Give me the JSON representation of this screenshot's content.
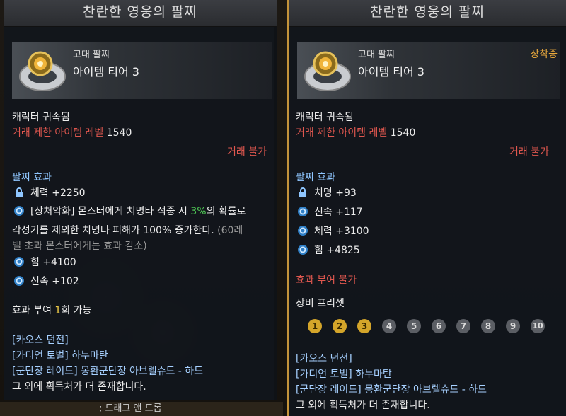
{
  "bottom_strip": "; 드래그 앤 드롭",
  "left": {
    "title": "찬란한 영웅의 팔찌",
    "item": {
      "grade": "고대 팔찌",
      "tier": "아이템 티어 3"
    },
    "bound": "캐릭터 귀속됨",
    "trade_level_label": "거래 제한 아이템 레벨",
    "trade_level_value": "1540",
    "trade_status": "거래 불가",
    "effects_header": "팔찌 효과",
    "effects": [
      {
        "icon": "lock-icon",
        "text": "체력 +2250"
      },
      {
        "icon": "swirl-icon",
        "text": "[상처악화] 몬스터에게 치명타 적중 시 ",
        "highlight": "3%",
        "suffix": "의 확률로"
      }
    ],
    "effect_cont_1": "각성기를 제외한 치명타 피해가 100% 증가한다.",
    "effect_cont_1_gray": " (60레",
    "effect_cont_2": "벨 초과 몬스터에게는 효과 감소)",
    "stats": [
      {
        "icon": "swirl-icon",
        "text": "힘 +4100"
      },
      {
        "icon": "swirl-icon",
        "text": "신속 +102"
      }
    ],
    "grant_prefix": "효과 부여 ",
    "grant_count": "1",
    "grant_suffix": "회 가능",
    "sources": [
      "[카오스 던전]",
      "[가디언 토벌] 하누마탄",
      "[군단장 레이드] 몽환군단장 아브렐슈드 - 하드"
    ],
    "more": "그 외에 획득처가 더 존재합니다."
  },
  "right": {
    "title": "찬란한 영웅의 팔찌",
    "item": {
      "grade": "고대 팔찌",
      "tier": "아이템 티어 3",
      "equipped": "장착중"
    },
    "bound": "캐릭터 귀속됨",
    "trade_level_label": "거래 제한 아이템 레벨",
    "trade_level_value": "1540",
    "trade_status": "거래 불가",
    "effects_header": "팔찌 효과",
    "effects": [
      {
        "icon": "lock-icon",
        "text": "치명 +93"
      },
      {
        "icon": "swirl-icon",
        "text": "신속 +117"
      },
      {
        "icon": "swirl-icon",
        "text": "체력 +3100"
      },
      {
        "icon": "swirl-icon",
        "text": "힘 +4825"
      }
    ],
    "grant_status": "효과 부여 불가",
    "preset_header": "장비 프리셋",
    "presets": [
      {
        "label": "1",
        "active": true
      },
      {
        "label": "2",
        "active": true
      },
      {
        "label": "3",
        "active": true
      },
      {
        "label": "4",
        "active": false
      },
      {
        "label": "5",
        "active": false
      },
      {
        "label": "6",
        "active": false
      },
      {
        "label": "7",
        "active": false
      },
      {
        "label": "8",
        "active": false
      },
      {
        "label": "9",
        "active": false
      },
      {
        "label": "10",
        "active": false
      }
    ],
    "sources": [
      "[카오스 던전]",
      "[가디언 토벌] 하누마탄",
      "[군단장 레이드] 몽환군단장 아브렐슈드 - 하드"
    ],
    "more": "그 외에 획득처가 더 존재합니다."
  }
}
